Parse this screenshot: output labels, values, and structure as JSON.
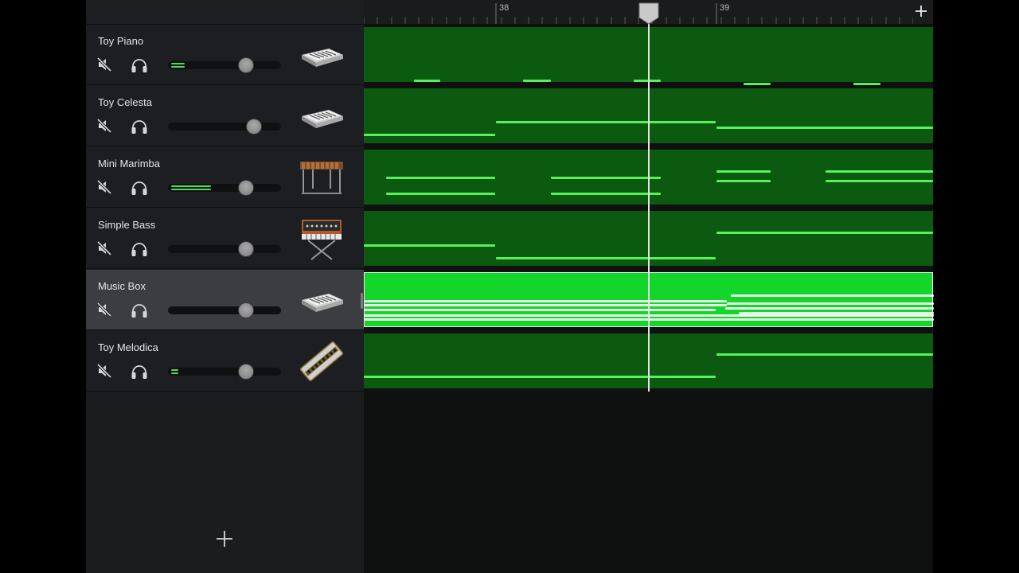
{
  "ruler": {
    "bars": [
      {
        "label": "38",
        "x_fraction": 0.232
      },
      {
        "label": "39",
        "x_fraction": 0.62
      }
    ]
  },
  "playhead": {
    "position_bar": 38.5
  },
  "tracks": [
    {
      "name": "Toy Piano",
      "instrument_icon": "keyboard-icon",
      "selected": false,
      "meter_lines": 2,
      "meter_level": 0.12,
      "volume": 0.69,
      "notes": [
        [
          0,
          86,
          51
        ],
        [
          63,
          66,
          96
        ],
        [
          97,
          86,
          133
        ],
        [
          131,
          86,
          166
        ],
        [
          166,
          86,
          200
        ],
        [
          200,
          66,
          235
        ],
        [
          235,
          86,
          270
        ],
        [
          270,
          86,
          304
        ],
        [
          304,
          86,
          339
        ],
        [
          339,
          66,
          373
        ],
        [
          373,
          86,
          408
        ],
        [
          408,
          86,
          442
        ],
        [
          442,
          86,
          477
        ],
        [
          477,
          70,
          511
        ],
        [
          511,
          86,
          546
        ],
        [
          546,
          81,
          580
        ],
        [
          580,
          86,
          615
        ],
        [
          615,
          70,
          649
        ],
        [
          649,
          86,
          684
        ],
        [
          684,
          82,
          715
        ]
      ]
    },
    {
      "name": "Toy Celesta",
      "instrument_icon": "keyboard-icon",
      "selected": false,
      "meter_lines": 0,
      "meter_level": 0,
      "volume": 0.76,
      "notes": [
        [
          0,
          57,
          165
        ],
        [
          166,
          41,
          442
        ],
        [
          443,
          48,
          715
        ]
      ]
    },
    {
      "name": "Mini Marimba",
      "instrument_icon": "marimba-icon",
      "selected": false,
      "meter_lines": 2,
      "meter_level": 0.35,
      "volume": 0.69,
      "notes": [
        [
          28,
          34,
          165
        ],
        [
          28,
          54,
          165
        ],
        [
          235,
          34,
          373
        ],
        [
          235,
          54,
          373
        ],
        [
          443,
          26,
          511
        ],
        [
          443,
          38,
          511
        ],
        [
          580,
          26,
          715
        ],
        [
          580,
          38,
          715
        ]
      ]
    },
    {
      "name": "Simple Bass",
      "instrument_icon": "synth-icon",
      "selected": false,
      "meter_lines": 0,
      "meter_level": 0,
      "volume": 0.69,
      "notes": [
        [
          0,
          42,
          165
        ],
        [
          166,
          58,
          442
        ],
        [
          443,
          26,
          715
        ]
      ]
    },
    {
      "name": "Music Box",
      "instrument_icon": "keyboard-icon",
      "selected": true,
      "meter_lines": 0,
      "meter_level": 0,
      "volume": 0.69,
      "notes": [
        [
          0,
          34,
          455
        ],
        [
          0,
          39,
          455
        ],
        [
          0,
          45,
          441
        ],
        [
          0,
          52,
          715
        ],
        [
          0,
          57,
          715
        ],
        [
          460,
          27,
          715
        ],
        [
          455,
          37,
          715
        ],
        [
          453,
          43,
          715
        ],
        [
          470,
          49,
          715
        ]
      ]
    },
    {
      "name": "Toy Melodica",
      "instrument_icon": "harmonica-icon",
      "selected": false,
      "meter_lines": 2,
      "meter_level": 0.06,
      "volume": 0.69,
      "notes": [
        [
          0,
          53,
          442
        ],
        [
          443,
          25,
          715
        ]
      ]
    }
  ]
}
